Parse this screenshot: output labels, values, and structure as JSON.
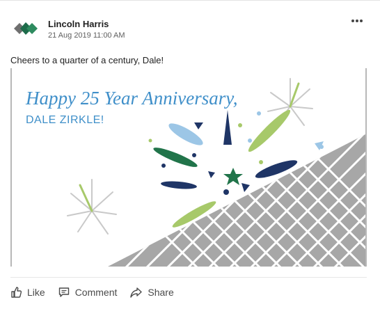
{
  "post": {
    "author": "Lincoln Harris",
    "timestamp": "21 Aug 2019 11:00 AM",
    "caption": "Cheers to a quarter of a century, Dale!",
    "more_icon": "more-horizontal-icon"
  },
  "image": {
    "headline": "Happy 25 Year Anniversary,",
    "subhead": "DALE ZIRKLE!",
    "colors": {
      "headline": "#3f8fc9",
      "navy": "#1f3566",
      "green": "#21744a",
      "light_green": "#a7c96a",
      "light_blue": "#9cc6e6",
      "tiles": "#a7a7a7"
    }
  },
  "actions": [
    {
      "label": "Like",
      "icon": "thumbs-up-icon"
    },
    {
      "label": "Comment",
      "icon": "comment-icon"
    },
    {
      "label": "Share",
      "icon": "share-icon"
    }
  ]
}
